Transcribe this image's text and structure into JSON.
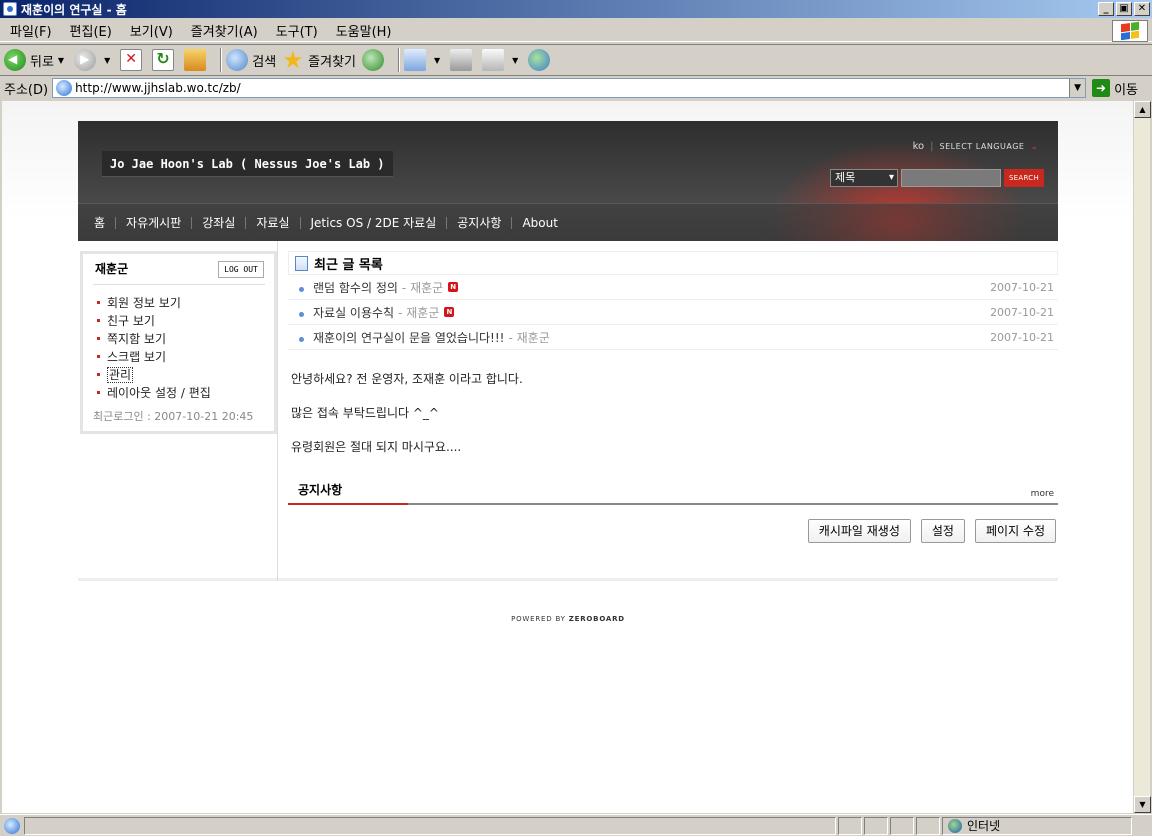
{
  "window": {
    "title": "재훈이의 연구실 - 홈",
    "buttons": [
      "_",
      "▣",
      "✕"
    ]
  },
  "menubar": [
    "파일(F)",
    "편집(E)",
    "보기(V)",
    "즐겨찾기(A)",
    "도구(T)",
    "도움말(H)"
  ],
  "toolbar": {
    "back_label": "뒤로",
    "search_label": "검색",
    "favorites_label": "즐겨찾기"
  },
  "address": {
    "label": "주소(D)",
    "url": "http://www.jjhslab.wo.tc/zb/",
    "go_label": "이동"
  },
  "site": {
    "title": "Jo Jae Hoon's Lab ( Nessus Joe's Lab )",
    "lang_code": "ko",
    "select_language": "SELECT LANGUAGE",
    "search_select": "제목",
    "search_button": "SEARCH",
    "nav": [
      "홈",
      "자유게시판",
      "강좌실",
      "자료실",
      "Jetics OS / 2DE 자료실",
      "공지사항",
      "About"
    ]
  },
  "login": {
    "user": "재훈군",
    "logout": "LOG OUT",
    "menu": [
      "회원 정보 보기",
      "친구 보기",
      "쪽지함 보기",
      "스크랩 보기",
      "관리",
      "레이아웃 설정 / 편집"
    ],
    "last_login": "최근로그인 : 2007-10-21 20:45"
  },
  "recent": {
    "title": "최근 글 목록",
    "posts": [
      {
        "title": "랜덤 함수의 정의",
        "author": "- 재훈군",
        "new": true,
        "date": "2007-10-21"
      },
      {
        "title": "자료실 이용수칙",
        "author": "- 재훈군",
        "new": true,
        "date": "2007-10-21"
      },
      {
        "title": "재훈이의 연구실이 문을 열었습니다!!!",
        "author": "- 재훈군",
        "new": false,
        "date": "2007-10-21"
      }
    ],
    "new_badge": "N"
  },
  "intro": [
    "안녕하세요? 전 운영자, 조재훈 이라고 합니다.",
    "많은 접속 부탁드립니다 ^_^",
    "유령회원은 절대 되지 마시구요...."
  ],
  "notice": {
    "title": "공지사항",
    "more": "more"
  },
  "actions": [
    "캐시파일 재생성",
    "설정",
    "페이지 수정"
  ],
  "powered": {
    "prefix": "POWERED BY ",
    "brand": "ZEROBOARD"
  },
  "status": {
    "zone": "인터넷"
  }
}
